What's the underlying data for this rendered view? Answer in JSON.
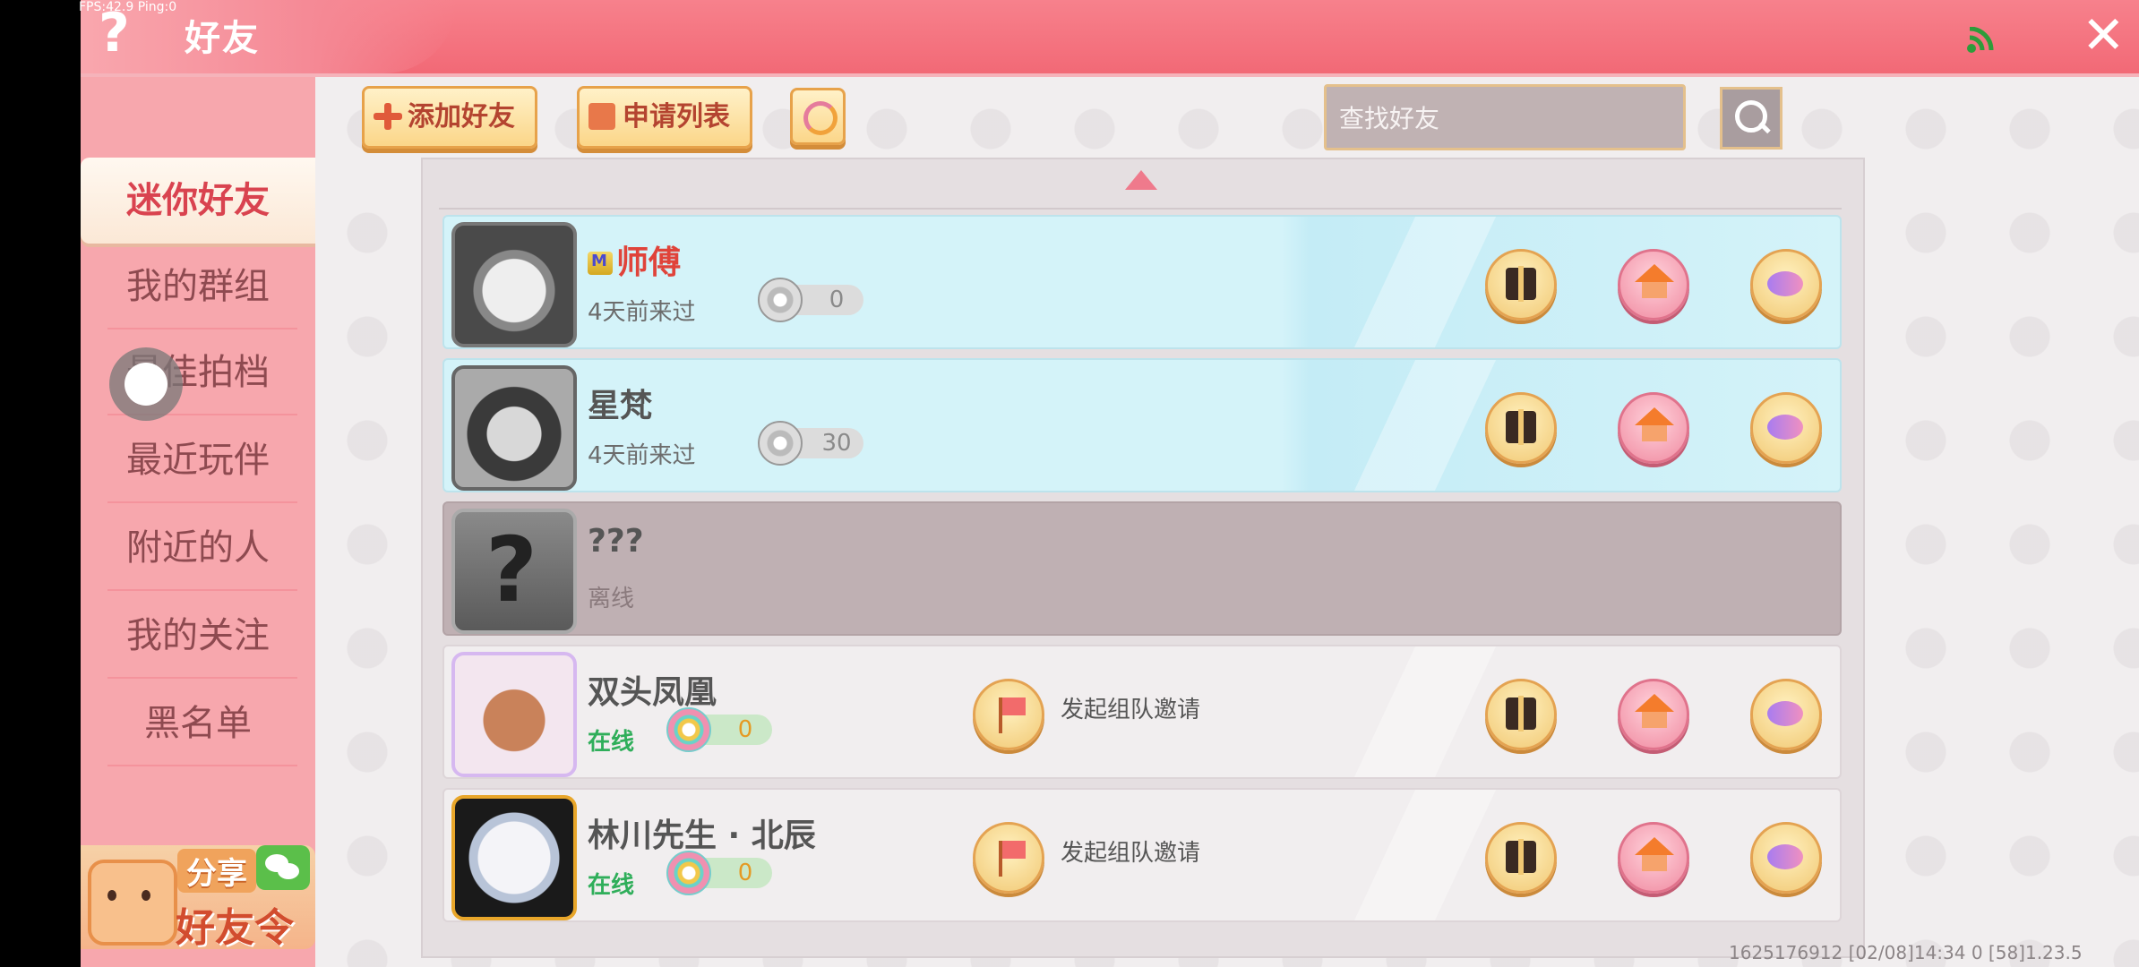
{
  "debug_overlay": "FPS:42.9  Ping:0",
  "header": {
    "help_glyph": "?",
    "title": "好友",
    "close_glyph": "✕",
    "signal_color": "#2e9c3a"
  },
  "sidebar": {
    "items": [
      {
        "label": "迷你好友",
        "active": true
      },
      {
        "label": "我的群组",
        "active": false
      },
      {
        "label": "最佳拍档",
        "active": false
      },
      {
        "label": "最近玩伴",
        "active": false
      },
      {
        "label": "附近的人",
        "active": false
      },
      {
        "label": "我的关注",
        "active": false
      },
      {
        "label": "黑名单",
        "active": false
      }
    ],
    "share": {
      "top_label": "分享",
      "bottom_label": "好友令"
    }
  },
  "toolbar": {
    "add_friend_label": "添加好友",
    "request_list_label": "申请列表",
    "search": {
      "placeholder": "查找好友",
      "value": ""
    }
  },
  "friends": [
    {
      "name": "师傅",
      "status": "4天前来过",
      "score": "0",
      "vip": true,
      "invite_label": ""
    },
    {
      "name": "星梵",
      "status": "4天前来过",
      "score": "30",
      "vip": false,
      "invite_label": ""
    },
    {
      "name": "???",
      "status": "离线",
      "score": "",
      "vip": false,
      "invite_label": ""
    },
    {
      "name": "双头凤凰",
      "status": "在线",
      "score": "0",
      "vip": false,
      "invite_label": "发起组队邀请"
    },
    {
      "name": "林川先生 · 北辰",
      "status": "在线",
      "score": "0",
      "vip": false,
      "invite_label": "发起组队邀请"
    }
  ],
  "footer": {
    "info": "1625176912    [02/08]14:34 0    [58]1.23.5"
  },
  "colors": {
    "header_pink": "#f26976",
    "sidebar_pink": "#f7a7ad",
    "active_text": "#d9434f",
    "online_green": "#2fae5a",
    "card_blue": "#d4f3f9",
    "card_offline": "#bfb0b3"
  }
}
